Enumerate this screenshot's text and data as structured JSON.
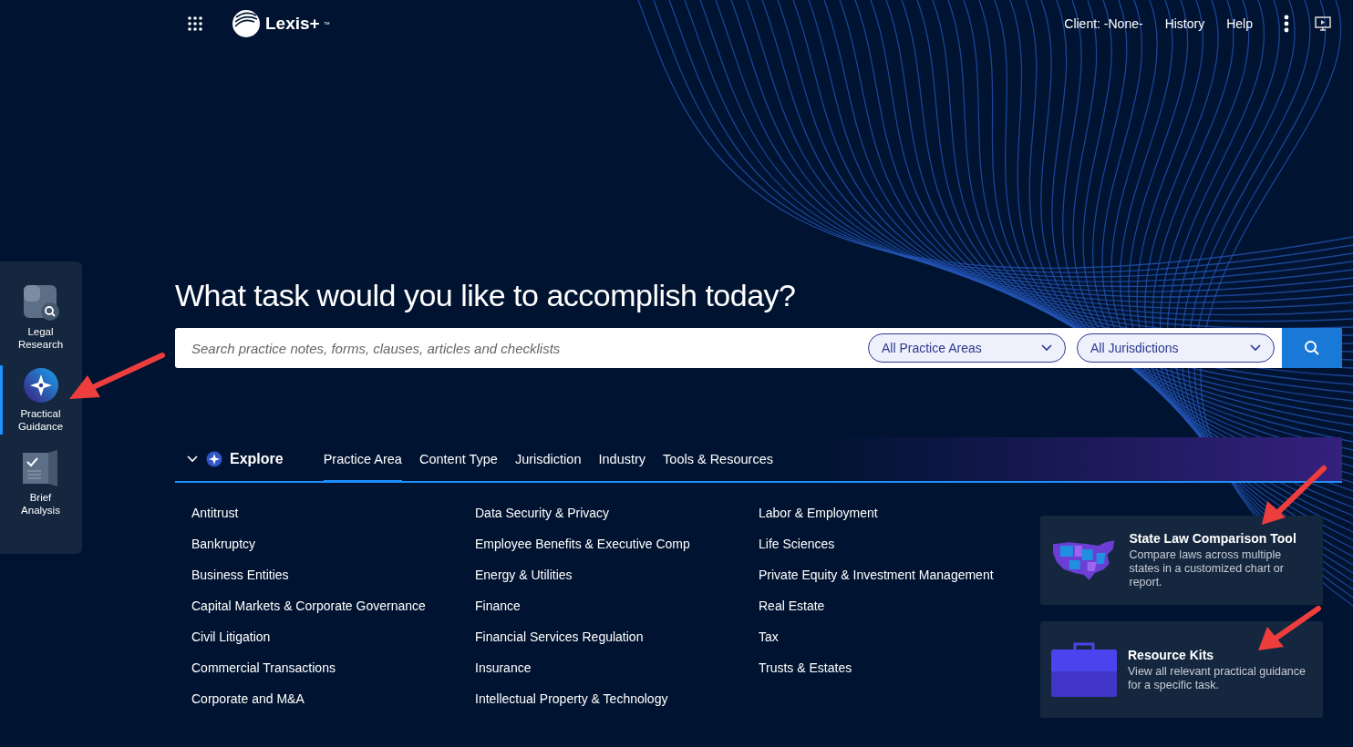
{
  "topbar": {
    "logo": "Lexis+",
    "trademark": "™",
    "links": [
      {
        "label": "Client: -None-"
      },
      {
        "label": "History"
      },
      {
        "label": "Help"
      }
    ]
  },
  "sidebar": {
    "items": [
      {
        "label": "Legal Research",
        "kind": "research",
        "selected": false
      },
      {
        "label": "Practical Guidance",
        "kind": "guidance",
        "selected": true
      },
      {
        "label": "Brief Analysis",
        "kind": "brief",
        "selected": false
      }
    ]
  },
  "headline": "What task would you like to accomplish today?",
  "search": {
    "placeholder": "Search practice notes, forms, clauses, articles and checklists",
    "filters": [
      {
        "label": "All Practice Areas"
      },
      {
        "label": "All Jurisdictions"
      }
    ]
  },
  "explore": {
    "title": "Explore",
    "expanded": true,
    "tabs": [
      {
        "label": "Practice Area",
        "selected": true
      },
      {
        "label": "Content Type",
        "selected": false
      },
      {
        "label": "Jurisdiction",
        "selected": false
      },
      {
        "label": "Industry",
        "selected": false
      },
      {
        "label": "Tools & Resources",
        "selected": false
      }
    ],
    "columns": [
      [
        "Antitrust",
        "Bankruptcy",
        "Business Entities",
        "Capital Markets & Corporate Governance",
        "Civil Litigation",
        "Commercial Transactions",
        "Corporate and M&A"
      ],
      [
        "Data Security & Privacy",
        "Employee Benefits & Executive Comp",
        "Energy & Utilities",
        "Finance",
        "Financial Services Regulation",
        "Insurance",
        "Intellectual Property & Technology"
      ],
      [
        "Labor & Employment",
        "Life Sciences",
        "Private Equity & Investment Management",
        "Real Estate",
        "Tax",
        "Trusts & Estates"
      ]
    ],
    "cards": [
      {
        "kind": "map",
        "title": "State Law Comparison Tool",
        "text": "Compare laws across multiple states in a customized chart or report."
      },
      {
        "kind": "briefcase",
        "title": "Resource Kits",
        "text": "View all relevant practical guidance for a specific task."
      }
    ]
  }
}
